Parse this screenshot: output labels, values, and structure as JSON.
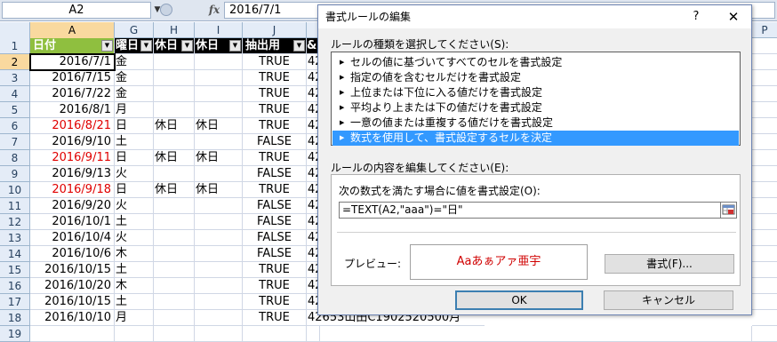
{
  "formula_bar": {
    "name_box": "A2",
    "fx_label": "fx",
    "formula": "2016/7/1"
  },
  "columns": [
    "A",
    "G",
    "H",
    "I",
    "J",
    "P"
  ],
  "rows": [
    "1",
    "2",
    "3",
    "4",
    "5",
    "6",
    "7",
    "8",
    "9",
    "10",
    "11",
    "12",
    "13",
    "14",
    "15",
    "16",
    "17",
    "18",
    "19"
  ],
  "header_row": {
    "A": "日付",
    "G": "曜日",
    "H": "休日",
    "I": "休日",
    "J": "抽出用",
    "K": "&"
  },
  "data_rows": [
    {
      "date": "2016/7/1",
      "dow": "金",
      "h": "",
      "i": "",
      "j": "TRUE",
      "k": "42",
      "red": false
    },
    {
      "date": "2016/7/15",
      "dow": "金",
      "h": "",
      "i": "",
      "j": "TRUE",
      "k": "42",
      "red": false
    },
    {
      "date": "2016/7/22",
      "dow": "金",
      "h": "",
      "i": "",
      "j": "TRUE",
      "k": "42",
      "red": false
    },
    {
      "date": "2016/8/1",
      "dow": "月",
      "h": "",
      "i": "",
      "j": "TRUE",
      "k": "42",
      "red": false
    },
    {
      "date": "2016/8/21",
      "dow": "日",
      "h": "休日",
      "i": "休日",
      "j": "TRUE",
      "k": "42",
      "red": true
    },
    {
      "date": "2016/9/10",
      "dow": "土",
      "h": "",
      "i": "",
      "j": "FALSE",
      "k": "42",
      "red": false
    },
    {
      "date": "2016/9/11",
      "dow": "日",
      "h": "休日",
      "i": "休日",
      "j": "TRUE",
      "k": "42",
      "red": true
    },
    {
      "date": "2016/9/13",
      "dow": "火",
      "h": "",
      "i": "",
      "j": "FALSE",
      "k": "42",
      "red": false
    },
    {
      "date": "2016/9/18",
      "dow": "日",
      "h": "休日",
      "i": "休日",
      "j": "TRUE",
      "k": "42",
      "red": true
    },
    {
      "date": "2016/9/20",
      "dow": "火",
      "h": "",
      "i": "",
      "j": "FALSE",
      "k": "42",
      "red": false
    },
    {
      "date": "2016/10/1",
      "dow": "土",
      "h": "",
      "i": "",
      "j": "FALSE",
      "k": "42",
      "red": false
    },
    {
      "date": "2016/10/4",
      "dow": "火",
      "h": "",
      "i": "",
      "j": "FALSE",
      "k": "42",
      "red": false
    },
    {
      "date": "2016/10/6",
      "dow": "木",
      "h": "",
      "i": "",
      "j": "FALSE",
      "k": "42",
      "red": false
    },
    {
      "date": "2016/10/15",
      "dow": "土",
      "h": "",
      "i": "",
      "j": "TRUE",
      "k": "42",
      "red": false
    },
    {
      "date": "2016/10/20",
      "dow": "木",
      "h": "",
      "i": "",
      "j": "TRUE",
      "k": "42",
      "red": false
    },
    {
      "date": "2016/10/15",
      "dow": "土",
      "h": "",
      "i": "",
      "j": "TRUE",
      "k": "42",
      "red": false
    },
    {
      "date": "2016/10/10",
      "dow": "月",
      "h": "",
      "i": "",
      "j": "TRUE",
      "k": "42653山田C1902520500月",
      "red": false
    }
  ],
  "dialog": {
    "title": "書式ルールの編集",
    "help": "?",
    "close": "✕",
    "rule_type_label": "ルールの種類を選択してください(S):",
    "rule_types": [
      "セルの値に基づいてすべてのセルを書式設定",
      "指定の値を含むセルだけを書式設定",
      "上位または下位に入る値だけを書式設定",
      "平均より上または下の値だけを書式設定",
      "一意の値または重複する値だけを書式設定",
      "数式を使用して、書式設定するセルを決定"
    ],
    "selected_rule_index": 5,
    "edit_label": "ルールの内容を編集してください(E):",
    "formula_label": "次の数式を満たす場合に値を書式設定(O):",
    "formula_value": "=TEXT(A2,\"aaa\")=\"日\"",
    "preview_label": "プレビュー:",
    "preview_text": "Aaあぁアァ亜宇",
    "format_button": "書式(F)...",
    "ok_button": "OK",
    "cancel_button": "キャンセル"
  },
  "colors": {
    "header_fill": "#000000",
    "col_a_header_fill": "#8fbf3f",
    "selected_rule": "#3399ff",
    "sunday_text": "#e00000"
  }
}
